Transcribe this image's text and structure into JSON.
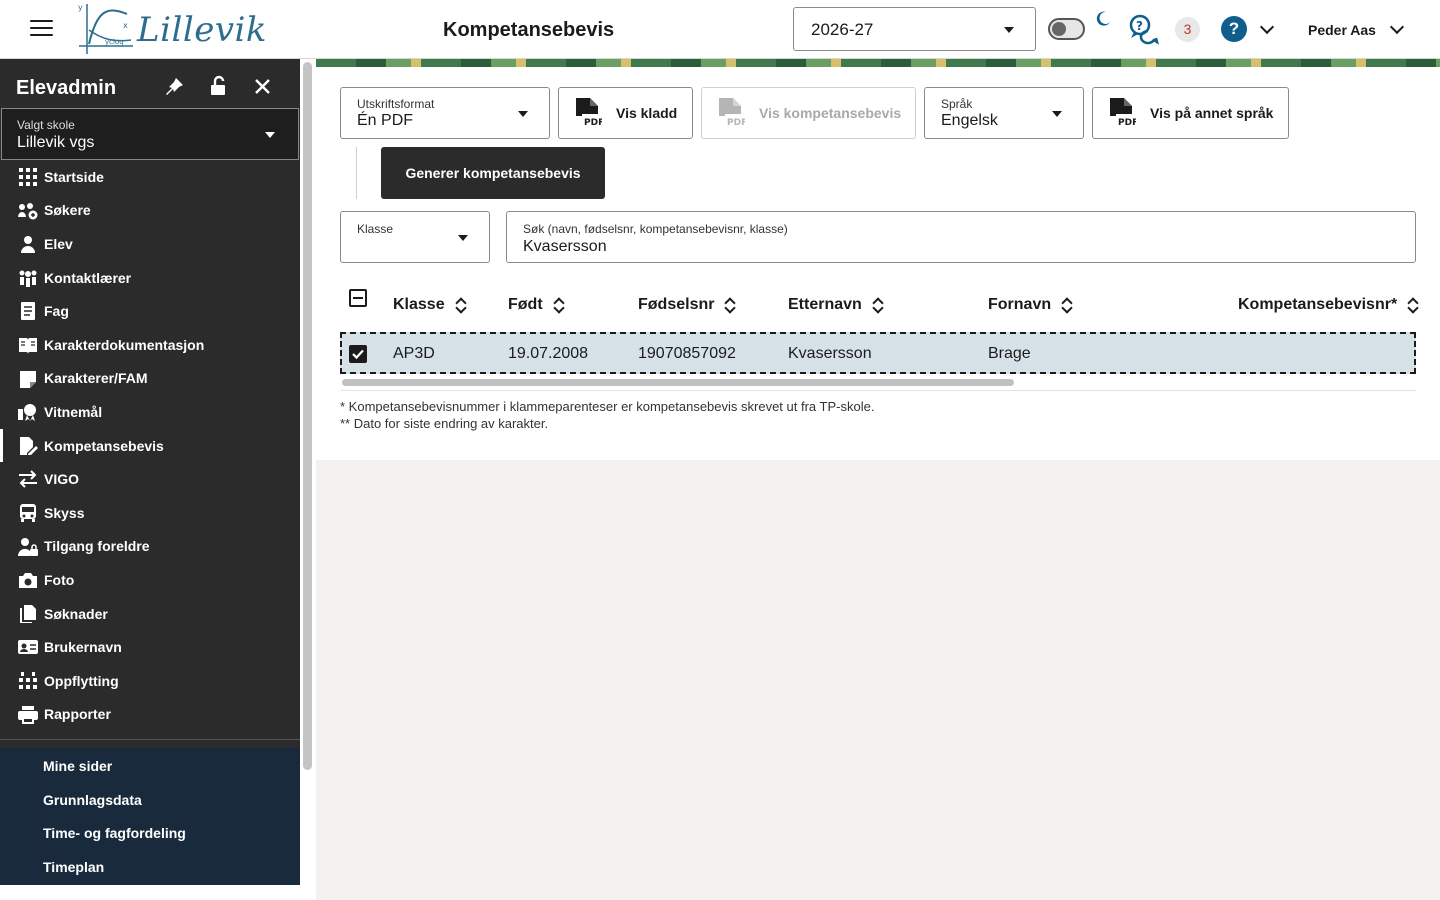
{
  "header": {
    "brand": "Lillevik",
    "title": "Kompetansebevis",
    "school_year": "2026-27",
    "notification_count": "3",
    "help_label": "?",
    "user_name": "Peder Aas"
  },
  "sidebar": {
    "title": "Elevadmin",
    "school_select": {
      "label": "Valgt skole",
      "value": "Lillevik vgs"
    },
    "items": [
      {
        "label": "Startside",
        "icon": "grid-icon"
      },
      {
        "label": "Søkere",
        "icon": "applicants-icon"
      },
      {
        "label": "Elev",
        "icon": "person-icon"
      },
      {
        "label": "Kontaktlærer",
        "icon": "contact-teacher-icon"
      },
      {
        "label": "Fag",
        "icon": "book-icon"
      },
      {
        "label": "Karakterdokumentasjon",
        "icon": "open-book-icon"
      },
      {
        "label": "Karakterer/FAM",
        "icon": "note-icon"
      },
      {
        "label": "Vitnemål",
        "icon": "diploma-icon"
      },
      {
        "label": "Kompetansebevis",
        "icon": "certificate-edit-icon"
      },
      {
        "label": "VIGO",
        "icon": "swap-arrows-icon"
      },
      {
        "label": "Skyss",
        "icon": "bus-icon"
      },
      {
        "label": "Tilgang foreldre",
        "icon": "parent-lock-icon"
      },
      {
        "label": "Foto",
        "icon": "camera-icon"
      },
      {
        "label": "Søknader",
        "icon": "documents-icon"
      },
      {
        "label": "Brukernavn",
        "icon": "id-card-icon"
      },
      {
        "label": "Oppflytting",
        "icon": "calendar-icon"
      },
      {
        "label": "Rapporter",
        "icon": "printer-icon"
      }
    ],
    "active_item": "Kompetansebevis",
    "bottom_links": [
      "Mine sider",
      "Grunnlagsdata",
      "Time- og fagfordeling",
      "Timeplan"
    ]
  },
  "toolbar": {
    "print_format": {
      "label": "Utskriftsformat",
      "value": "Én PDF"
    },
    "draft_button": "Vis kladd",
    "show_certificate_button": "Vis kompetansebevis",
    "language": {
      "label": "Språk",
      "value": "Engelsk"
    },
    "other_language_button": "Vis på annet språk",
    "generate_button": "Generer kompetansebevis",
    "pdf_icon_text": "PDF"
  },
  "filters": {
    "class": {
      "label": "Klasse",
      "value": ""
    },
    "search": {
      "label": "Søk (navn, fødselsnr, kompetansebevisnr, klasse)",
      "value": "Kvasersson"
    }
  },
  "table": {
    "columns": [
      "Klasse",
      "Født",
      "Fødselsnr",
      "Etternavn",
      "Fornavn",
      "Kompetansebevisnr*"
    ],
    "rows": [
      {
        "klasse": "AP3D",
        "fodt": "19.07.2008",
        "fodselsnr": "19070857092",
        "etternavn": "Kvasersson",
        "fornavn": "Brage",
        "kompetansebevisnr": "",
        "selected": true
      }
    ]
  },
  "notes": [
    "* Kompetansebevisnummer i klammeparenteser er kompetansebevis skrevet ut fra TP-skole.",
    "** Dato for siste endring av karakter."
  ],
  "colors": {
    "sidebar_bg": "#2b2b2b",
    "sidebar_bottom_bg": "#1a2a3d",
    "accent_blue": "#0e5f8c",
    "selected_row_bg": "#d7e1e8",
    "badge_text": "#c0392b"
  }
}
